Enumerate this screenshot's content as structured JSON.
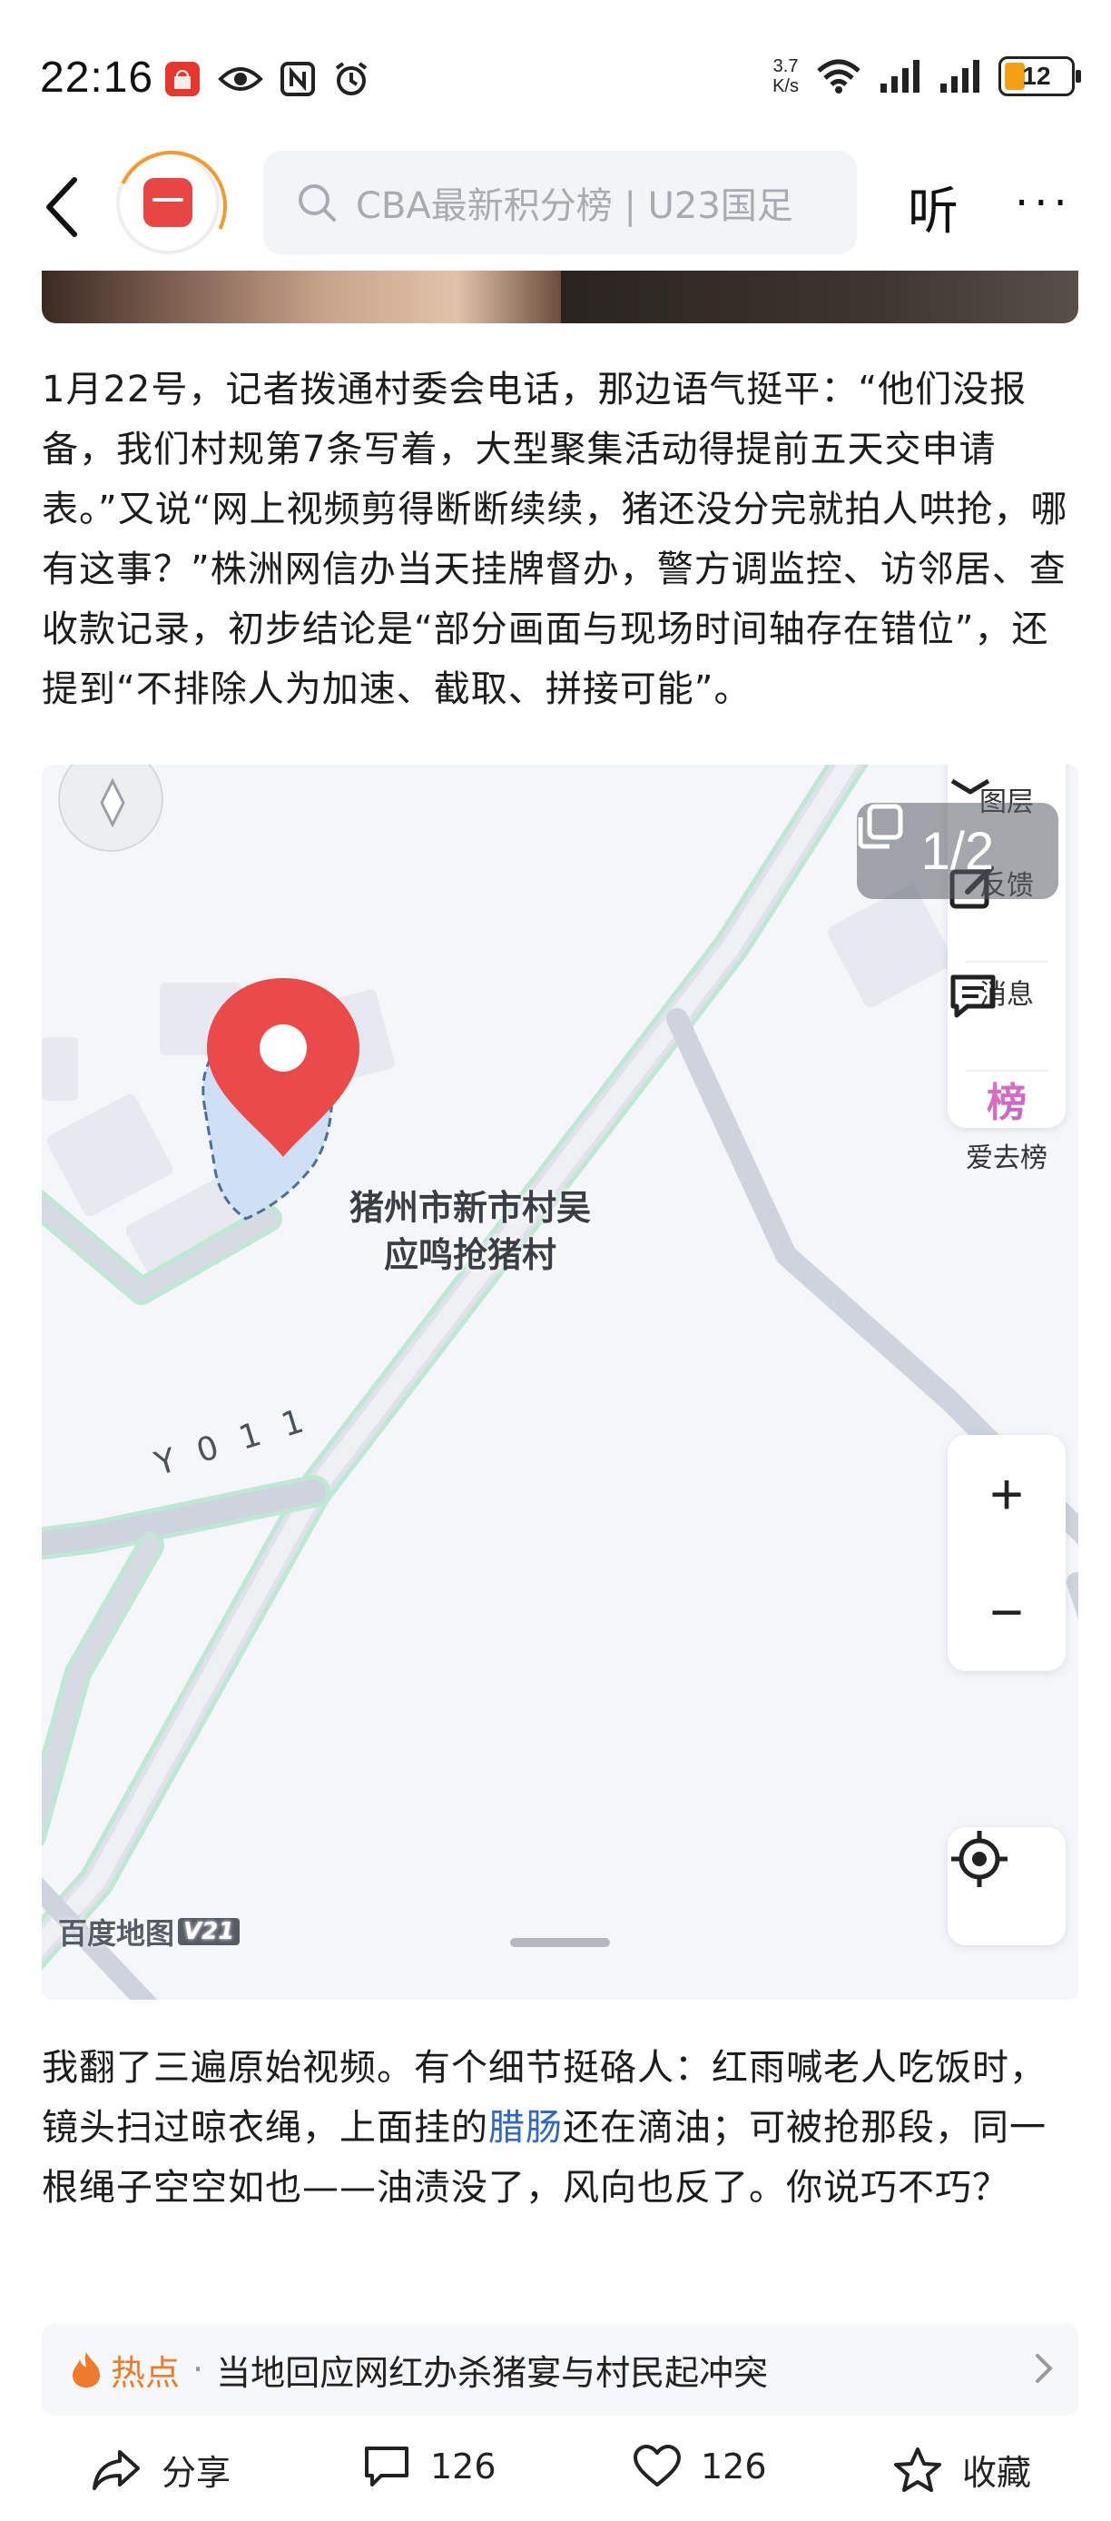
{
  "status_bar": {
    "time": "22:16",
    "net_speed_value": "3.7",
    "net_speed_unit": "K/s",
    "battery": "12",
    "icons": [
      "huawei-app-icon",
      "eye-icon",
      "nfc-icon",
      "alarm-icon",
      "wifi-icon",
      "signal-icon",
      "signal-icon",
      "battery-icon"
    ]
  },
  "nav": {
    "back_icon": "chevron-left-icon",
    "search_placeholder": "CBA最新积分榜 | U23国足",
    "listen_label": "听",
    "more_label": "···"
  },
  "article": {
    "paragraph1": "1月22号，记者拨通村委会电话，那边语气挺平：“他们没报备，我们村规第7条写着，大型聚集活动得提前五天交申请表。”又说“网上视频剪得断断续续，猪还没分完就拍人哄抢，哪有这事？”株洲网信办当天挂牌督办，警方调监控、访邻居、查收款记录，初步结论是“部分画面与现场时间轴存在错位”，还提到“不排除人为加速、截取、拼接可能”。",
    "paragraph2_before": "我翻了三遍原始视频。有个细节挺硌人：红雨喊老人吃饭时，镜头扫过晾衣绳，上面挂的",
    "paragraph2_link": "腊肠",
    "paragraph2_after": "还在滴油；可被抢那段，同一根绳子空空如也——油渍没了，风向也反了。你说巧不巧？"
  },
  "map": {
    "page_indicator": "1/2",
    "place_label": "猪州市新市村吴应鸣抢猪村",
    "road_label": "Y011",
    "side_panel": [
      {
        "label": "图层",
        "icon": "layers-icon"
      },
      {
        "label": "反馈",
        "icon": "edit-icon"
      },
      {
        "label": "消息",
        "icon": "message-icon"
      },
      {
        "label": "爱去榜",
        "icon": "ranking-icon",
        "icon_text": "榜"
      }
    ],
    "zoom_in": "+",
    "zoom_out": "−",
    "logo_text": "百度地图",
    "logo_version": "V21"
  },
  "hot": {
    "label": "热点",
    "separator": "·",
    "text": "当地回应网红办杀猪宴与村民起冲突"
  },
  "bottom_bar": {
    "share_label": "分享",
    "comment_count": "126",
    "like_count": "126",
    "favorite_label": "收藏"
  },
  "colors": {
    "accent_orange": "#ee7a2b",
    "link_blue": "#3165c6",
    "pin_red": "#ea4a4a",
    "road_green": "#8fd6b4"
  }
}
